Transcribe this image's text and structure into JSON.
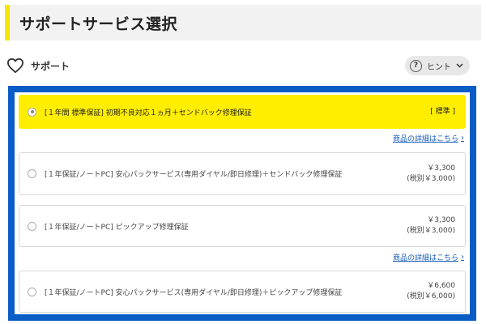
{
  "header": {
    "title": "サポートサービス選択"
  },
  "support": {
    "label": "サポート",
    "hint_label": "ヒント"
  },
  "options": [
    {
      "label": "[１年間 標準保証] 初期不良対応１ヵ月＋センドバック修理保証",
      "price": "[ 標準 ]",
      "price_tax": "",
      "selected": true
    },
    {
      "label": "[１年保証/ノートPC] 安心パックサービス(専用ダイヤル/即日修理)＋センドバック修理保証",
      "price": "￥3,300",
      "price_tax": "(税別￥3,000)",
      "selected": false
    },
    {
      "label": "[１年保証/ノートPC] ピックアップ修理保証",
      "price": "￥3,300",
      "price_tax": "(税別￥3,000)",
      "selected": false
    },
    {
      "label": "[１年保証/ノートPC] 安心パックサービス(専用ダイヤル/即日修理)＋ピックアップ修理保証",
      "price": "￥6,600",
      "price_tax": "(税別￥6,000)",
      "selected": false
    }
  ],
  "links": {
    "product_detail_1": "商品の詳細はこちら",
    "product_detail_2": "商品の詳細はこちら"
  },
  "colors": {
    "accent_yellow": "#ffee00",
    "frame_blue": "#0a5cc7",
    "link_blue": "#1a5bb8"
  }
}
